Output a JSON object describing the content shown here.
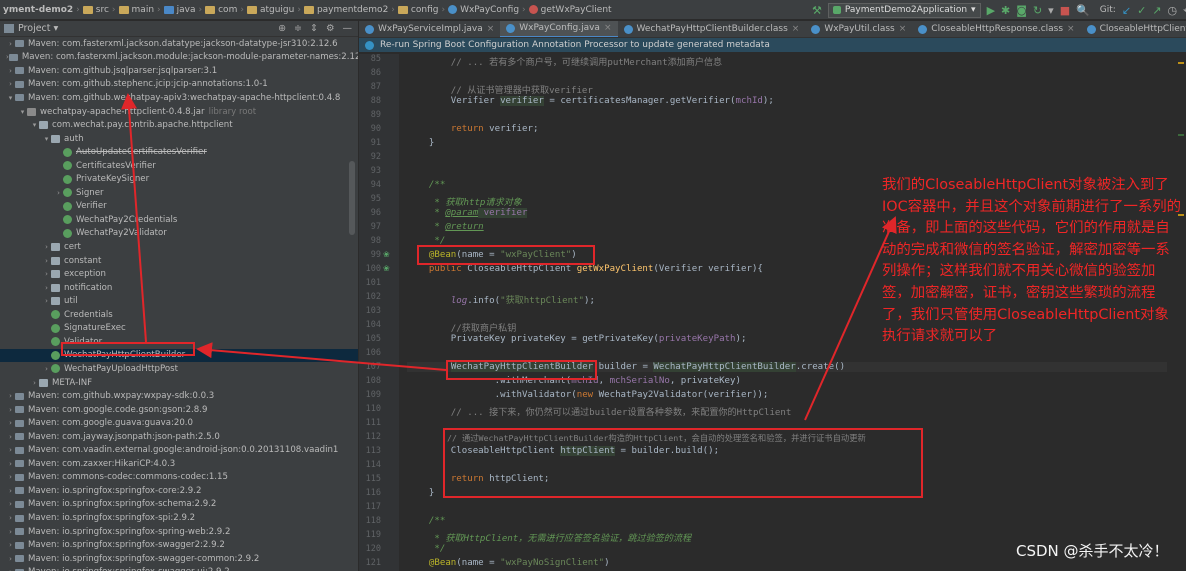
{
  "topbar": {
    "breadcrumbs": [
      "yment-demo2",
      "src",
      "main",
      "java",
      "com",
      "atguigu",
      "paymentdemo2",
      "config",
      "WxPayConfig",
      "getWxPayClient"
    ],
    "run_config": "PaymentDemo2Application",
    "git_label": "Git:"
  },
  "sidebar": {
    "title": "Project",
    "rows": [
      {
        "text": "Maven: com.fasterxml.jackson.datatype:jackson-datatype-jsr310:2.12.6",
        "indent": 0,
        "icon": "library",
        "arrow": "right"
      },
      {
        "text": "Maven: com.fasterxml.jackson.module:jackson-module-parameter-names:2.12",
        "indent": 0,
        "icon": "library",
        "arrow": "right"
      },
      {
        "text": "Maven: com.github.jsqlparser:jsqlparser:3.1",
        "indent": 0,
        "icon": "library",
        "arrow": "right"
      },
      {
        "text": "Maven: com.github.stephenc.jcip:jcip-annotations:1.0-1",
        "indent": 0,
        "icon": "library",
        "arrow": "right"
      },
      {
        "text": "Maven: com.github.wechatpay-apiv3:wechatpay-apache-httpclient:0.4.8",
        "indent": 0,
        "icon": "library",
        "arrow": "down"
      },
      {
        "text": "wechatpay-apache-httpclient-0.4.8.jar",
        "indent": 1,
        "icon": "jar",
        "arrow": "down",
        "suffix": "library root"
      },
      {
        "text": "com.wechat.pay.contrib.apache.httpclient",
        "indent": 2,
        "icon": "package",
        "arrow": "down"
      },
      {
        "text": "auth",
        "indent": 3,
        "icon": "folder",
        "arrow": "down"
      },
      {
        "text": "AutoUpdateCertificatesVerifier",
        "indent": 4,
        "icon": "class",
        "arrow": "",
        "strike": true
      },
      {
        "text": "CertificatesVerifier",
        "indent": 4,
        "icon": "class",
        "arrow": ""
      },
      {
        "text": "PrivateKeySigner",
        "indent": 4,
        "icon": "class",
        "arrow": ""
      },
      {
        "text": "Signer",
        "indent": 4,
        "icon": "interface",
        "arrow": "right"
      },
      {
        "text": "Verifier",
        "indent": 4,
        "icon": "interface",
        "arrow": ""
      },
      {
        "text": "WechatPay2Credentials",
        "indent": 4,
        "icon": "class",
        "arrow": ""
      },
      {
        "text": "WechatPay2Validator",
        "indent": 4,
        "icon": "class",
        "arrow": ""
      },
      {
        "text": "cert",
        "indent": 3,
        "icon": "folder",
        "arrow": "right"
      },
      {
        "text": "constant",
        "indent": 3,
        "icon": "folder",
        "arrow": "right"
      },
      {
        "text": "exception",
        "indent": 3,
        "icon": "folder",
        "arrow": "right"
      },
      {
        "text": "notification",
        "indent": 3,
        "icon": "folder",
        "arrow": "right"
      },
      {
        "text": "util",
        "indent": 3,
        "icon": "folder",
        "arrow": "right"
      },
      {
        "text": "Credentials",
        "indent": 3,
        "icon": "interface",
        "arrow": ""
      },
      {
        "text": "SignatureExec",
        "indent": 3,
        "icon": "class",
        "arrow": ""
      },
      {
        "text": "Validator",
        "indent": 3,
        "icon": "interface",
        "arrow": ""
      },
      {
        "text": "WechatPayHttpClientBuilder",
        "indent": 3,
        "icon": "class",
        "arrow": "",
        "selected": true
      },
      {
        "text": "WechatPayUploadHttpPost",
        "indent": 3,
        "icon": "class",
        "arrow": "right"
      },
      {
        "text": "META-INF",
        "indent": 2,
        "icon": "folder",
        "arrow": "right"
      },
      {
        "text": "Maven: com.github.wxpay:wxpay-sdk:0.0.3",
        "indent": 0,
        "icon": "library",
        "arrow": "right"
      },
      {
        "text": "Maven: com.google.code.gson:gson:2.8.9",
        "indent": 0,
        "icon": "library",
        "arrow": "right"
      },
      {
        "text": "Maven: com.google.guava:guava:20.0",
        "indent": 0,
        "icon": "library",
        "arrow": "right"
      },
      {
        "text": "Maven: com.jayway.jsonpath:json-path:2.5.0",
        "indent": 0,
        "icon": "library",
        "arrow": "right"
      },
      {
        "text": "Maven: com.vaadin.external.google:android-json:0.0.20131108.vaadin1",
        "indent": 0,
        "icon": "library",
        "arrow": "right"
      },
      {
        "text": "Maven: com.zaxxer:HikariCP:4.0.3",
        "indent": 0,
        "icon": "library",
        "arrow": "right"
      },
      {
        "text": "Maven: commons-codec:commons-codec:1.15",
        "indent": 0,
        "icon": "library",
        "arrow": "right"
      },
      {
        "text": "Maven: io.springfox:springfox-core:2.9.2",
        "indent": 0,
        "icon": "library",
        "arrow": "right"
      },
      {
        "text": "Maven: io.springfox:springfox-schema:2.9.2",
        "indent": 0,
        "icon": "library",
        "arrow": "right"
      },
      {
        "text": "Maven: io.springfox:springfox-spi:2.9.2",
        "indent": 0,
        "icon": "library",
        "arrow": "right"
      },
      {
        "text": "Maven: io.springfox:springfox-spring-web:2.9.2",
        "indent": 0,
        "icon": "library",
        "arrow": "right"
      },
      {
        "text": "Maven: io.springfox:springfox-swagger2:2.9.2",
        "indent": 0,
        "icon": "library",
        "arrow": "right"
      },
      {
        "text": "Maven: io.springfox:springfox-swagger-common:2.9.2",
        "indent": 0,
        "icon": "library",
        "arrow": "right"
      },
      {
        "text": "Maven: io.springfox:springfox-swagger-ui:2.9.2",
        "indent": 0,
        "icon": "library",
        "arrow": "right"
      }
    ]
  },
  "tabs": [
    {
      "label": "WxPayServiceImpl.java",
      "active": false
    },
    {
      "label": "WxPayConfig.java",
      "active": true
    },
    {
      "label": "WechatPayHttpClientBuilder.class",
      "active": false
    },
    {
      "label": "WxPayUtil.class",
      "active": false
    },
    {
      "label": "CloseableHttpResponse.class",
      "active": false
    },
    {
      "label": "CloseableHttpClient.class",
      "active": false
    },
    {
      "label": "HttpClientUti",
      "active": false
    }
  ],
  "notice": "Re-run Spring Boot Configuration Annotation Processor to update generated metadata",
  "code": {
    "line_numbers": [
      "85",
      "86",
      "87",
      "88",
      "89",
      "90",
      "91",
      "92",
      "93",
      "94",
      "95",
      "96",
      "97",
      "98",
      "99",
      "100",
      "101",
      "102",
      "103",
      "104",
      "105",
      "106",
      "107",
      "108",
      "109",
      "110",
      "111",
      "112",
      "113",
      "114",
      "115",
      "116",
      "117",
      "118",
      "119",
      "120",
      "121"
    ],
    "l85": "        // ... 若有多个商户号，可继续调用putMerchant添加商户信息",
    "l87": "        // 从证书管理器中获取verifier",
    "l88a": "        Verifier ",
    "l88b": "verifier",
    "l88c": " = certificatesManager.getVerifier(",
    "l88d": "mchId",
    "l88e": ");",
    "l90a": "        ",
    "l90b": "return",
    "l90c": " verifier;",
    "l91": "    }",
    "l94": "    /**",
    "l95": "     * 获取http请求对象",
    "l96a": "     * ",
    "l96b": "@param",
    "l96c": " verifier",
    "l97a": "     * ",
    "l97b": "@return",
    "l98": "     */",
    "l99a": "    @Bean",
    "l99b": "(name = ",
    "l99c": "\"wxPayClient\"",
    "l99d": ")",
    "l100a": "    public",
    "l100b": " CloseableHttpClient ",
    "l100c": "getWxPayClient",
    "l100d": "(Verifier verifier){",
    "l102a": "        ",
    "l102b": "log",
    "l102c": ".info(",
    "l102d": "\"获取httpClient\"",
    "l102e": ");",
    "l104": "        //获取商户私钥",
    "l105a": "        PrivateKey privateKey = getPrivateKey(",
    "l105b": "privateKeyPath",
    "l105c": ");",
    "l107a": "        ",
    "l107b": "WechatPayHttpClientBuilder",
    "l107c": " builder = ",
    "l107d": "WechatPayHttpClientBuilder",
    "l107e": ".create()",
    "l108a": "                .withMerchant(",
    "l108b": "mchId",
    "l108c": ", ",
    "l108d": "mchSerialNo",
    "l108e": ", privateKey)",
    "l109a": "                .withValidator(",
    "l109b": "new",
    "l109c": " WechatPay2Validator(verifier));",
    "l110": "        // ... 接下来，你仍然可以通过builder设置各种参数，来配置你的HttpClient",
    "l112": "        // 通过WechatPayHttpClientBuilder构造的HttpClient，会自动的处理签名和验签，并进行证书自动更新",
    "l113a": "        CloseableHttpClient ",
    "l113b": "httpClient",
    "l113c": " = builder.build();",
    "l115a": "        ",
    "l115b": "return",
    "l115c": " httpClient;",
    "l116": "    }",
    "l119": "    /**",
    "l120": "     * 获取HttpClient，无需进行应答签名验证，跳过验签的流程",
    "l121": "     */",
    "l122a": "    @Bean",
    "l122b": "(name = ",
    "l122c": "\"wxPayNoSignClient\"",
    "l122d": ")"
  },
  "annotation_text": "我们的CloseableHttpClient对象被注入到了IOC容器中，并且这个对象前期进行了一系列的准备，即上面的这些代码，它们的作用就是自动的完成和微信的签名验证，解密加密等一系列操作；这样我们就不用关心微信的验签加签，加密解密，证书，密钥这些繁琐的流程了，我们只管使用CloseableHttpClient对象执行请求就可以了",
  "watermark": "CSDN @杀手不太冷！",
  "colors": {
    "annotation_red": "#e0262a",
    "selection": "#0d293e",
    "editor_bg": "#2b2b2b"
  }
}
